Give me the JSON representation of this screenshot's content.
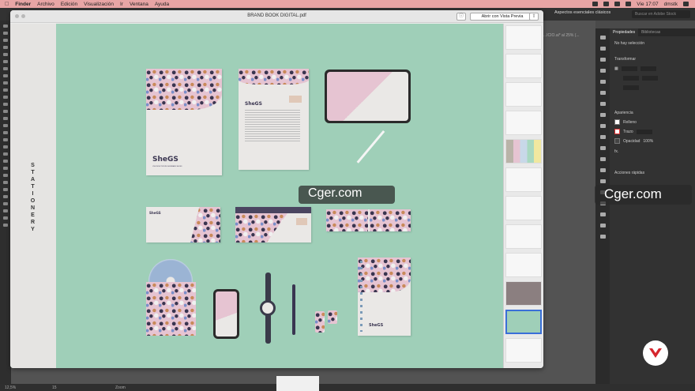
{
  "menubar": {
    "apple": "",
    "items": [
      "Finder",
      "Archivo",
      "Edición",
      "Visualización",
      "Ir",
      "Ventana",
      "Ayuda"
    ],
    "clock": "Vie 17:07",
    "user": "dmstk"
  },
  "illustrator": {
    "workspace": "Aspectos esenciales clásicos",
    "search_placeholder": "Buscar en Adobe Stock",
    "doc_tab": "...ICIO.ai* al 25% (...",
    "panel_tabs": [
      "Propiedades",
      "Bibliotecas"
    ],
    "no_selection": "No hay selección",
    "transform": "Transformar",
    "appearance": "Apariencia",
    "fill": "Relleno",
    "stroke": "Trazo",
    "opacity": "Opacidad",
    "opacity_value": "100%",
    "fx": "fx.",
    "quick_actions": "Acciones rápidas",
    "status_zoom": "12,5%",
    "status_page": "15",
    "status_tool": "Zoom"
  },
  "preview": {
    "title": "BRAND BOOK DIGITAL.pdf",
    "open_button": "Abrir con Vista Previa",
    "section_label": "STATIONERY",
    "brand_name": "SheGS",
    "tagline": "LIVE IN MOTION IN SHOEMAKE SHOES"
  },
  "watermark": "Cger.com",
  "colors": {
    "page_bg": "#9fcfb8",
    "pattern_pink": "#e6c4d2",
    "brand_dark": "#3a3550",
    "menubar": "#e8a5a5",
    "badge_red": "#d6262d"
  }
}
